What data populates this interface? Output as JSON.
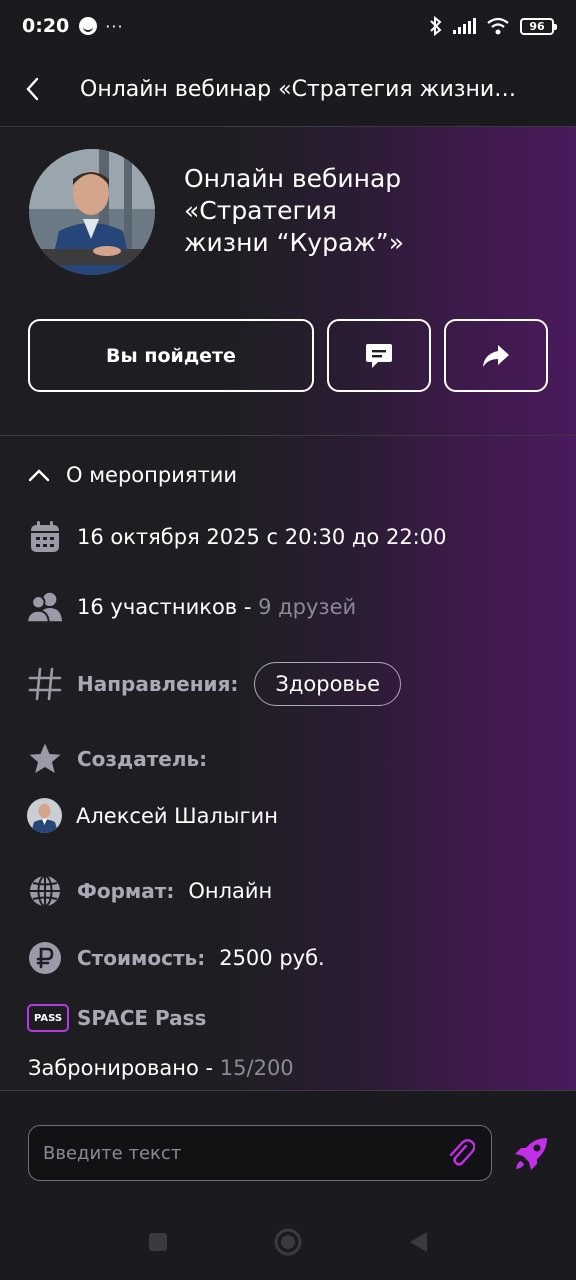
{
  "status": {
    "time": "0:20",
    "dots": "···",
    "battery": "96"
  },
  "header": {
    "title": "Онлайн вебинар «Стратегия жизни…"
  },
  "event": {
    "title_lines": [
      "Онлайн вебинар",
      "«Стратегия",
      "жизни “Кураж”»"
    ]
  },
  "actions": {
    "attend_label": "Вы пойдете"
  },
  "about": {
    "toggle_label": "О мероприятии",
    "date_text": "16 октября 2025 с 20:30 до 22:00",
    "participants_text": "16 участников - ",
    "friends_text": "9 друзей",
    "directions_label": "Направления:",
    "direction_tag": "Здоровье",
    "creator_label": "Создатель:",
    "creator_name": "Алексей Шалыгин",
    "format_label": "Формат:",
    "format_value": "Онлайн",
    "cost_label": "Стоимость:",
    "cost_value": "2500 руб.",
    "pass_badge": "PASS",
    "pass_label": "SPACE Pass",
    "booked_label": "Забронировано - ",
    "booked_value": "15/200"
  },
  "composer": {
    "placeholder": "Введите текст"
  },
  "colors": {
    "accent": "#b43be0",
    "muted": "#8a8a96",
    "bg": "#1e1e22",
    "purple": "#4a1a5c"
  },
  "icons": [
    "chevron-left-icon",
    "chat-icon",
    "share-icon",
    "chevron-up-icon",
    "calendar-icon",
    "people-icon",
    "hashtag-icon",
    "star-icon",
    "globe-icon",
    "ruble-icon",
    "paperclip-icon",
    "rocket-icon"
  ]
}
